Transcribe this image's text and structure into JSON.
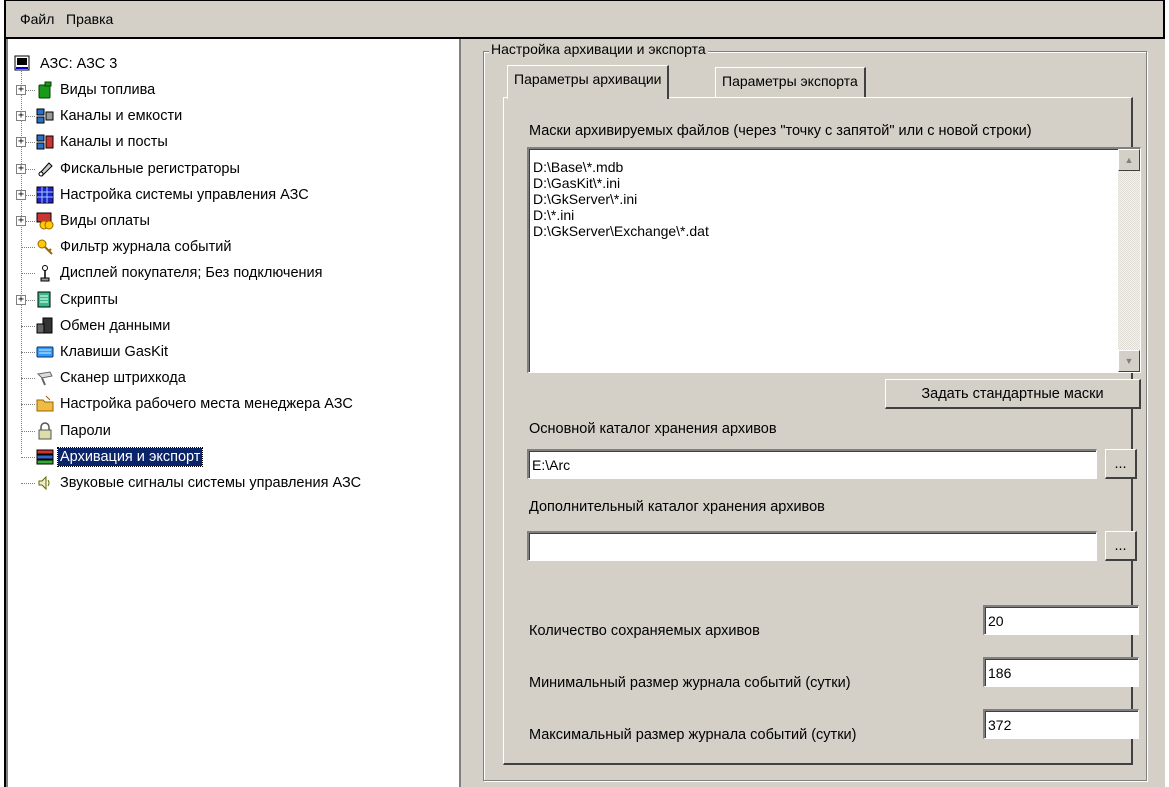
{
  "menu": [
    {
      "label": "Файл"
    },
    {
      "label": "Правка"
    }
  ],
  "tree": {
    "root": "АЗС: АЗС 3",
    "items": [
      {
        "label": "Виды топлива",
        "icon": "fuel-canister-icon",
        "expandable": true
      },
      {
        "label": "Каналы и емкости",
        "icon": "network-tanks-icon",
        "expandable": true
      },
      {
        "label": "Каналы и посты",
        "icon": "network-posts-icon",
        "expandable": true
      },
      {
        "label": "Фискальные регистраторы",
        "icon": "fiscal-register-icon",
        "expandable": true
      },
      {
        "label": "Настройка системы управления АЗС",
        "icon": "grid-settings-icon",
        "expandable": true
      },
      {
        "label": "Виды оплаты",
        "icon": "payment-coins-icon",
        "expandable": true
      },
      {
        "label": "Фильтр журнала событий",
        "icon": "key-filter-icon",
        "expandable": false
      },
      {
        "label": "Дисплей покупателя; Без подключения",
        "icon": "joystick-icon",
        "expandable": false
      },
      {
        "label": "Скрипты",
        "icon": "scripts-icon",
        "expandable": true
      },
      {
        "label": "Обмен данными",
        "icon": "data-exchange-icon",
        "expandable": false
      },
      {
        "label": "Клавиши GasKit",
        "icon": "keyboard-icon",
        "expandable": false
      },
      {
        "label": "Сканер штрихкода",
        "icon": "barcode-scanner-icon",
        "expandable": false
      },
      {
        "label": "Настройка рабочего места менеджера АЗС",
        "icon": "folder-manager-icon",
        "expandable": false
      },
      {
        "label": "Пароли",
        "icon": "lock-icon",
        "expandable": false
      },
      {
        "label": "Архивация и экспорт",
        "icon": "archive-books-icon",
        "expandable": false,
        "selected": true
      },
      {
        "label": "Звуковые сигналы системы управления АЗС",
        "icon": "speaker-icon",
        "expandable": false
      }
    ]
  },
  "settings": {
    "group_title": "Настройка архивации и экспорта",
    "tabs": [
      {
        "label": "Параметры архивации",
        "active": true
      },
      {
        "label": "Параметры экспорта",
        "active": false
      }
    ],
    "masks_label": "Маски архивируемых файлов (через \"точку с запятой\" или с новой строки)",
    "masks": [
      "D:\\Base\\*.mdb",
      "D:\\GasKit\\*.ini",
      "D:\\GkServer\\*.ini",
      "D:\\*.ini",
      "D:\\GkServer\\Exchange\\*.dat"
    ],
    "default_masks_button": "Задать стандартные маски",
    "main_dir_label": "Основной каталог хранения архивов",
    "main_dir_value": "E:\\Arc",
    "extra_dir_label": "Дополнительный каталог хранения архивов",
    "extra_dir_value": "",
    "browse_label": "...",
    "archive_count_label": "Количество сохраняемых архивов",
    "archive_count_value": "20",
    "min_log_label": "Минимальный размер журнала событий (сутки)",
    "min_log_value": "186",
    "max_log_label": "Максимальный размер журнала событий (сутки)",
    "max_log_value": "372"
  }
}
